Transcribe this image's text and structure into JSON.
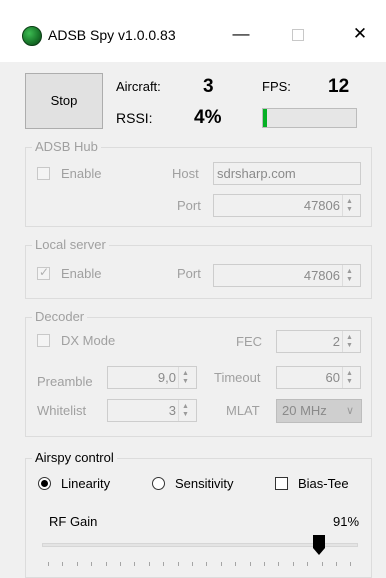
{
  "window": {
    "title": "ADSB Spy v1.0.0.83",
    "minimize_glyph": "—",
    "close_glyph": "✕"
  },
  "controls": {
    "stop_label": "Stop",
    "aircraft_label": "Aircraft:",
    "aircraft_value": "3",
    "fps_label": "FPS:",
    "fps_value": "12",
    "rssi_label": "RSSI:",
    "rssi_value": "4%",
    "signal_level_percent": 4
  },
  "adsb_hub": {
    "title": "ADSB Hub",
    "enable_label": "Enable",
    "enable_checked": false,
    "host_label": "Host",
    "host_value": "sdrsharp.com",
    "port_label": "Port",
    "port_value": "47806"
  },
  "local_server": {
    "title": "Local server",
    "enable_label": "Enable",
    "enable_checked": true,
    "port_label": "Port",
    "port_value": "47806"
  },
  "decoder": {
    "title": "Decoder",
    "dx_mode_label": "DX Mode",
    "dx_mode_checked": false,
    "fec_label": "FEC",
    "fec_value": "2",
    "preamble_label": "Preamble",
    "preamble_value": "9,0",
    "timeout_label": "Timeout",
    "timeout_value": "60",
    "whitelist_label": "Whitelist",
    "whitelist_value": "3",
    "mlat_label": "MLAT",
    "mlat_value": "20 MHz"
  },
  "airspy": {
    "title": "Airspy control",
    "linearity_label": "Linearity",
    "sensitivity_label": "Sensitivity",
    "mode_selected": "Linearity",
    "bias_tee_label": "Bias-Tee",
    "bias_tee_checked": false,
    "rf_gain_label": "RF Gain",
    "rf_gain_value": "91%"
  },
  "colors": {
    "signal_fill": "#06b025",
    "disabled_text": "#a0a0a0",
    "app_icon": "#2a9a3e"
  },
  "icons": {
    "app": "adsb-spy-green-globe-icon",
    "minimize": "minimize-icon",
    "maximize": "maximize-icon",
    "close": "close-icon",
    "spin_up": "arrow-up-icon",
    "spin_down": "arrow-down-icon",
    "dropdown": "chevron-down-icon",
    "slider_thumb": "slider-thumb-icon"
  }
}
